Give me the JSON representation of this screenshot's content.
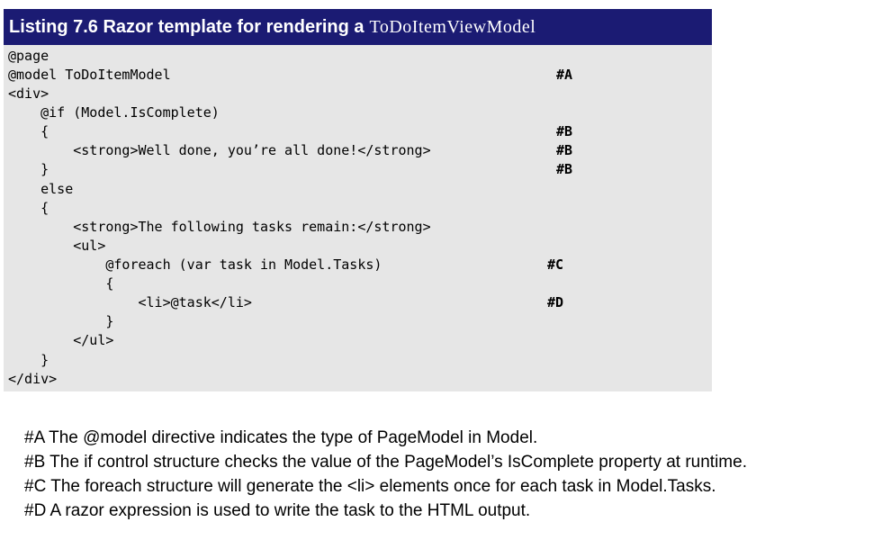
{
  "listing": {
    "title": "Listing 7.6 Razor template for rendering a",
    "title_code": "ToDoItemViewModel"
  },
  "code_lines": [
    "@page",
    "@model ToDoItemModel",
    "<div>",
    "    @if (Model.IsComplete)",
    "    {",
    "        <strong>Well done, you’re all done!</strong>",
    "    }",
    "    else",
    "    {",
    "        <strong>The following tasks remain:</strong>",
    "        <ul>",
    "            @foreach (var task in Model.Tasks)",
    "            {",
    "                <li>@task</li>",
    "            }",
    "        </ul>",
    "    }",
    "</div>"
  ],
  "annotations": [
    "#A",
    "#B",
    "#B",
    "#B",
    "#C",
    "#D"
  ],
  "notes": [
    "#A The @model directive indicates the type of PageModel in Model.",
    "#B The if control structure checks the value of the PageModel’s IsComplete property at runtime.",
    "#C The foreach structure will generate the <li> elements once for each task in Model.Tasks.",
    "#D A razor expression is used to write the task to the HTML output."
  ]
}
